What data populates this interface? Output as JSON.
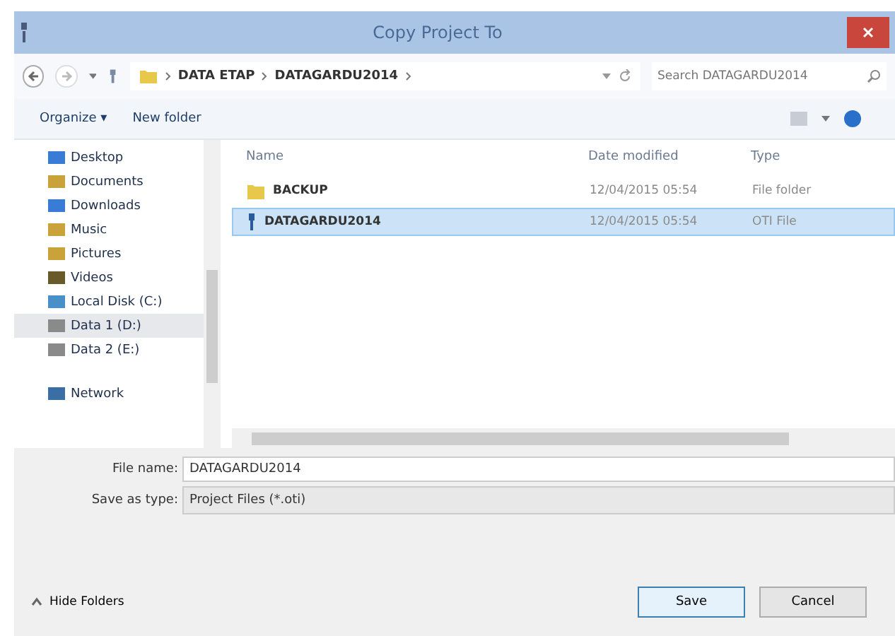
{
  "window": {
    "title": "Copy Project To"
  },
  "address": {
    "crumbs": [
      "DATA ETAP",
      "DATAGARDU2014"
    ]
  },
  "search": {
    "placeholder": "Search DATAGARDU2014"
  },
  "toolbar": {
    "organize": "Organize ▾",
    "new_folder": "New folder"
  },
  "sidebar": {
    "sections": [
      {
        "items": [
          {
            "label": "Desktop",
            "selected": false
          },
          {
            "label": "Documents",
            "selected": false
          },
          {
            "label": "Downloads",
            "selected": false
          },
          {
            "label": "Music",
            "selected": false
          },
          {
            "label": "Pictures",
            "selected": false
          },
          {
            "label": "Videos",
            "selected": false
          },
          {
            "label": "Local Disk (C:)",
            "selected": false
          },
          {
            "label": "Data 1 (D:)",
            "selected": true
          },
          {
            "label": "Data 2 (E:)",
            "selected": false
          }
        ]
      },
      {
        "items": [
          {
            "label": "Network",
            "selected": false
          }
        ]
      }
    ]
  },
  "table": {
    "columns": [
      "Name",
      "Date modified",
      "Type"
    ],
    "rows": [
      {
        "name": "BACKUP",
        "date": "12/04/2015 05:54",
        "type": "File folder",
        "kind": "folder",
        "selected": false
      },
      {
        "name": "DATAGARDU2014",
        "date": "12/04/2015 05:54",
        "type": "OTI File",
        "kind": "file",
        "selected": true
      }
    ]
  },
  "form": {
    "file_name_label": "File name:",
    "file_name": "DATAGARDU2014",
    "type_label": "Save as type:",
    "type_value": "Project Files (*.oti)"
  },
  "footer": {
    "hide_folders": "Hide Folders",
    "buttons": [
      "Save",
      "Cancel"
    ]
  }
}
